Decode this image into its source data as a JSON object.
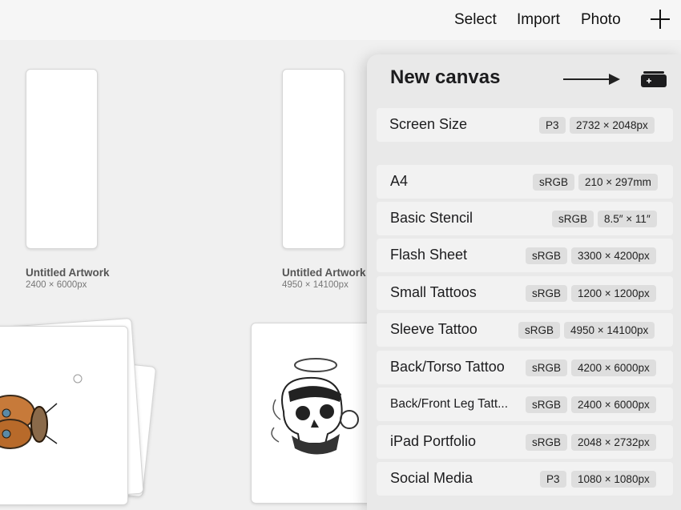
{
  "toolbar": {
    "select_label": "Select",
    "import_label": "Import",
    "photo_label": "Photo",
    "add_icon": "plus-icon"
  },
  "gallery": {
    "artworks": [
      {
        "title": "Untitled Artwork",
        "dims": "2400 × 6000px"
      },
      {
        "title": "Untitled Artwork",
        "dims": "4950 × 14100px"
      }
    ]
  },
  "new_canvas": {
    "title": "New canvas",
    "icon": "new-canvas-icon",
    "presets": [
      {
        "name": "Screen Size",
        "profile": "P3",
        "size": "2732 × 2048px"
      },
      {
        "name": "A4",
        "profile": "sRGB",
        "size": "210 × 297mm"
      },
      {
        "name": "Basic Stencil",
        "profile": "sRGB",
        "size": "8.5″ × 11″"
      },
      {
        "name": "Flash Sheet",
        "profile": "sRGB",
        "size": "3300 × 4200px"
      },
      {
        "name": "Small Tattoos",
        "profile": "sRGB",
        "size": "1200 × 1200px"
      },
      {
        "name": "Sleeve Tattoo",
        "profile": "sRGB",
        "size": "4950 × 14100px"
      },
      {
        "name": "Back/Torso Tattoo",
        "profile": "sRGB",
        "size": "4200 × 6000px"
      },
      {
        "name": "Back/Front Leg Tatt...",
        "profile": "sRGB",
        "size": "2400 × 6000px"
      },
      {
        "name": "iPad Portfolio",
        "profile": "sRGB",
        "size": "2048 × 2732px"
      },
      {
        "name": "Social Media",
        "profile": "P3",
        "size": "1080 × 1080px"
      }
    ]
  },
  "colors": {
    "background": "#f0f0f0",
    "panel": "#e9e9e9",
    "row": "#f2f2f2",
    "pill": "#dedede"
  }
}
